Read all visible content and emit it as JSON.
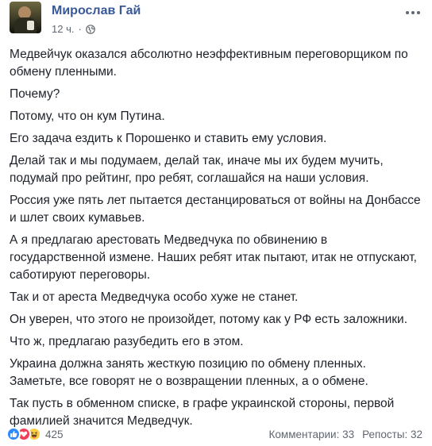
{
  "post": {
    "author": "Мирослав Гай",
    "time": "12 ч.",
    "separator": "·",
    "paragraphs": [
      "Медвейчук оказался абсолютно неэффективным переговорщиком по обмену пленными.",
      "Почему?",
      "Потому, что он кум Путина.",
      "Его задача ездить к Порошенко и ставить ему условия.",
      "Делай так и мы подумаем, делай так, иначе мы их будем мучить, подумай про рейтинг, про ребят, соглашайся на наши условия.",
      "Россия уже пять лет пытается дестанцироваться от войны на Донбассе и шлет своих кумавьев.",
      "А я предлагаю арестовать Медведчука по обвинению в государственной измене. Наших ребят итак пытают, итак не отпускают, саботируют переговоры.",
      "Так и от ареста Медведчука особо хуже не станет.",
      "Он уверен, что этого не произойдет, потому как у РФ есть заложники.",
      "Что ж, предлагаю разубедить его в этом.",
      "Украина должна занять жесткую позицию по обмену пленных. Заметьте, все говорят не о возвращении пленных, а о обмене.",
      "Так пусть в обменном списке, в графе украинской стороны, первой фамилией значится Медведчук."
    ]
  },
  "footer": {
    "reaction_count": "425",
    "comments": "Комментарии: 33",
    "shares": "Репосты: 32"
  },
  "icons": {
    "privacy": "globe-icon",
    "menu": "more-icon",
    "reactions": [
      "like-icon",
      "love-icon",
      "haha-icon"
    ]
  },
  "colors": {
    "author_link": "#385898",
    "text": "#1d2129",
    "secondary": "#616770",
    "like": "#2e89ff",
    "love": "#f33e58",
    "haha": "#fbcd44"
  }
}
